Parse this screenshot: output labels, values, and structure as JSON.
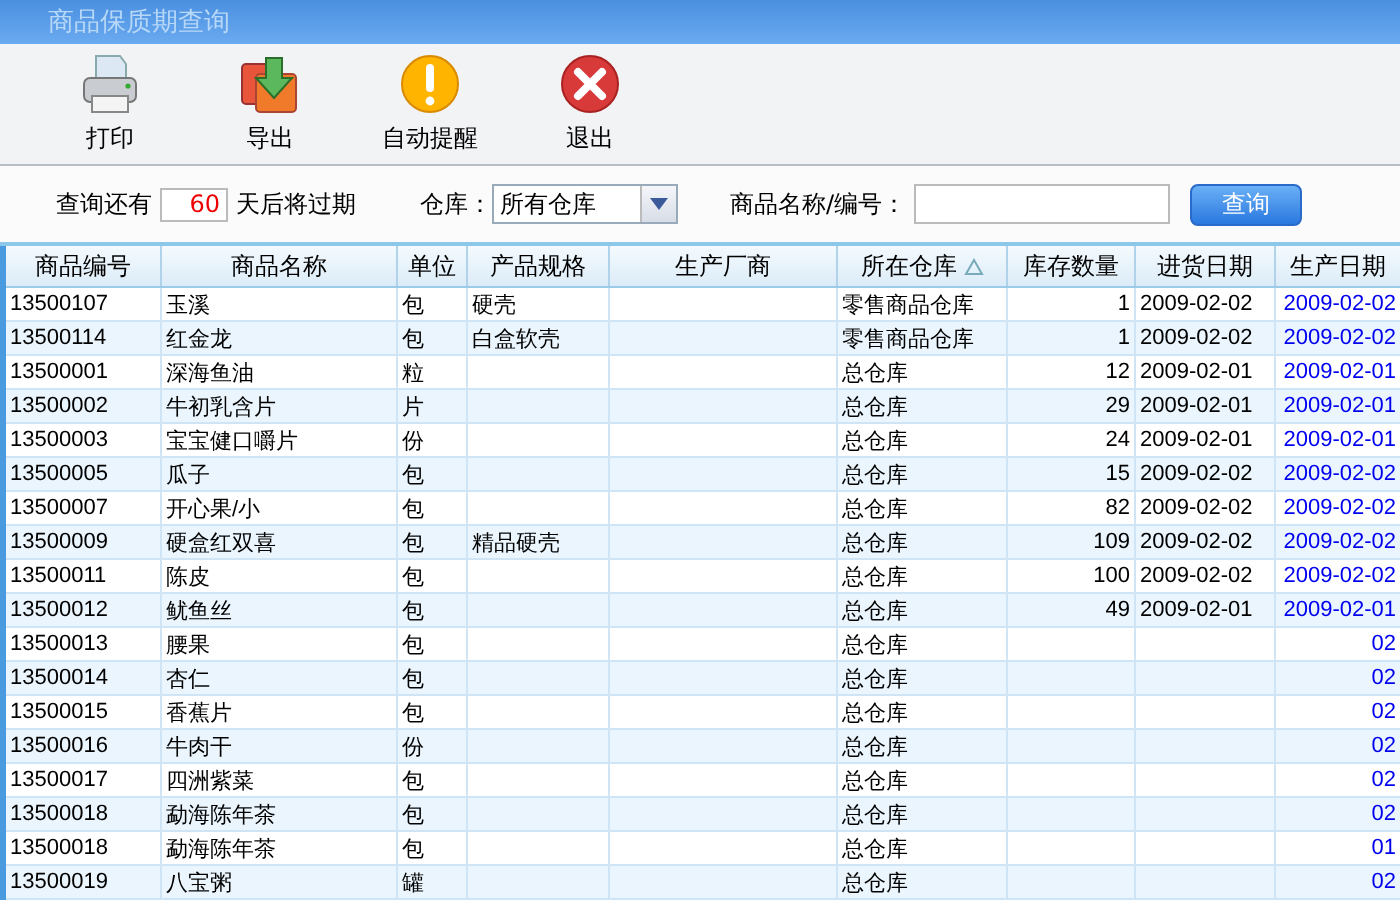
{
  "window": {
    "title": "商品保质期查询"
  },
  "toolbar": [
    {
      "kind": "print",
      "label": "打印"
    },
    {
      "kind": "export",
      "label": "导出"
    },
    {
      "kind": "alert",
      "label": "自动提醒"
    },
    {
      "kind": "exit",
      "label": "退出"
    }
  ],
  "filter": {
    "prefix": "查询还有",
    "days": "60",
    "suffix": "天后将过期",
    "warehouse_label": "仓库：",
    "warehouse_value": "所有仓库",
    "search_label": "商品名称/编号：",
    "query_button": "查询"
  },
  "table": {
    "columns": [
      {
        "label": "商品编号",
        "kind": "text",
        "sorted": false
      },
      {
        "label": "商品名称",
        "kind": "text",
        "sorted": false
      },
      {
        "label": "单位",
        "kind": "text",
        "sorted": false
      },
      {
        "label": "产品规格",
        "kind": "text",
        "sorted": false
      },
      {
        "label": "生产厂商",
        "kind": "text",
        "sorted": false
      },
      {
        "label": "所在仓库",
        "kind": "text",
        "sorted": true
      },
      {
        "label": "库存数量",
        "kind": "number",
        "sorted": false
      },
      {
        "label": "进货日期",
        "kind": "text",
        "sorted": false
      },
      {
        "label": "生产日期",
        "kind": "link",
        "sorted": false
      }
    ],
    "rows": [
      [
        "13500107",
        "玉溪",
        "包",
        "硬壳",
        null,
        "零售商品仓库",
        "1",
        "2009-02-02",
        "2009-02-02"
      ],
      [
        "13500114",
        "红金龙",
        "包",
        "白盒软壳",
        null,
        "零售商品仓库",
        "1",
        "2009-02-02",
        "2009-02-02"
      ],
      [
        "13500001",
        "深海鱼油",
        "粒",
        null,
        null,
        "总仓库",
        "12",
        "2009-02-01",
        "2009-02-01"
      ],
      [
        "13500002",
        "牛初乳含片",
        "片",
        null,
        null,
        "总仓库",
        "29",
        "2009-02-01",
        "2009-02-01"
      ],
      [
        "13500003",
        "宝宝健口嚼片",
        "份",
        null,
        null,
        "总仓库",
        "24",
        "2009-02-01",
        "2009-02-01"
      ],
      [
        "13500005",
        "瓜子",
        "包",
        null,
        null,
        "总仓库",
        "15",
        "2009-02-02",
        "2009-02-02"
      ],
      [
        "13500007",
        "开心果/小",
        "包",
        null,
        null,
        "总仓库",
        "82",
        "2009-02-02",
        "2009-02-02"
      ],
      [
        "13500009",
        "硬盒红双喜",
        "包",
        "精品硬壳",
        null,
        "总仓库",
        "109",
        "2009-02-02",
        "2009-02-02"
      ],
      [
        "13500011",
        "陈皮",
        "包",
        null,
        null,
        "总仓库",
        "100",
        "2009-02-02",
        "2009-02-02"
      ],
      [
        "13500012",
        "鱿鱼丝",
        "包",
        null,
        null,
        "总仓库",
        "49",
        "2009-02-01",
        "2009-02-01"
      ],
      [
        "13500013",
        "腰果",
        "包",
        null,
        null,
        "总仓库",
        null,
        null,
        "02"
      ],
      [
        "13500014",
        "杏仁",
        "包",
        null,
        null,
        "总仓库",
        null,
        null,
        "02"
      ],
      [
        "13500015",
        "香蕉片",
        "包",
        null,
        null,
        "总仓库",
        null,
        null,
        "02"
      ],
      [
        "13500016",
        "牛肉干",
        "份",
        null,
        null,
        "总仓库",
        null,
        null,
        "02"
      ],
      [
        "13500017",
        "四洲紫菜",
        "包",
        null,
        null,
        "总仓库",
        null,
        null,
        "02"
      ],
      [
        "13500018",
        "勐海陈年茶",
        "包",
        null,
        null,
        "总仓库",
        null,
        null,
        "02"
      ],
      [
        "13500018",
        "勐海陈年茶",
        "包",
        null,
        null,
        "总仓库",
        null,
        null,
        "01"
      ],
      [
        "13500019",
        "八宝粥",
        "罐",
        null,
        null,
        "总仓库",
        null,
        null,
        "02"
      ]
    ]
  }
}
